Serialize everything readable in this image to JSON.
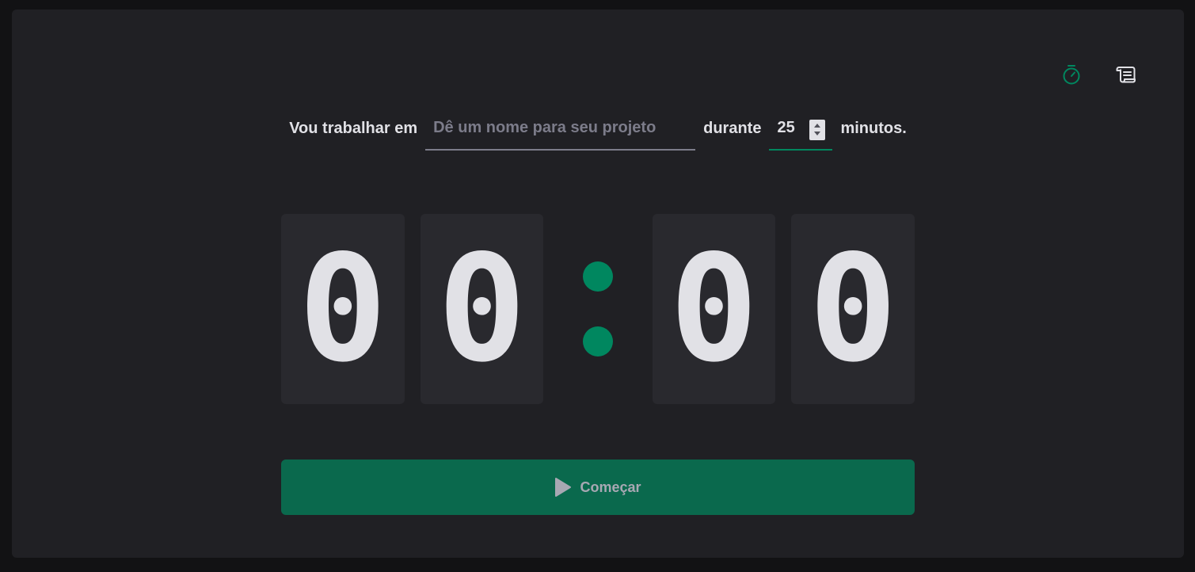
{
  "nav": {
    "timer_icon": "timer-icon",
    "history_icon": "scroll-icon"
  },
  "form": {
    "label_task": "Vou trabalhar em",
    "task_placeholder": "Dê um nome para seu projeto",
    "task_value": "",
    "label_during": "durante",
    "minutes_value": "25",
    "label_minutes": "minutos."
  },
  "countdown": {
    "minutes_tens": "0",
    "minutes_ones": "0",
    "seconds_tens": "0",
    "seconds_ones": "0"
  },
  "start_button": {
    "label": "Começar",
    "icon": "play-icon"
  },
  "colors": {
    "accent": "#00875f",
    "button_bg": "#0a694d",
    "panel_bg": "#202024",
    "digit_bg": "#29292e",
    "text": "#e1e1e6"
  }
}
